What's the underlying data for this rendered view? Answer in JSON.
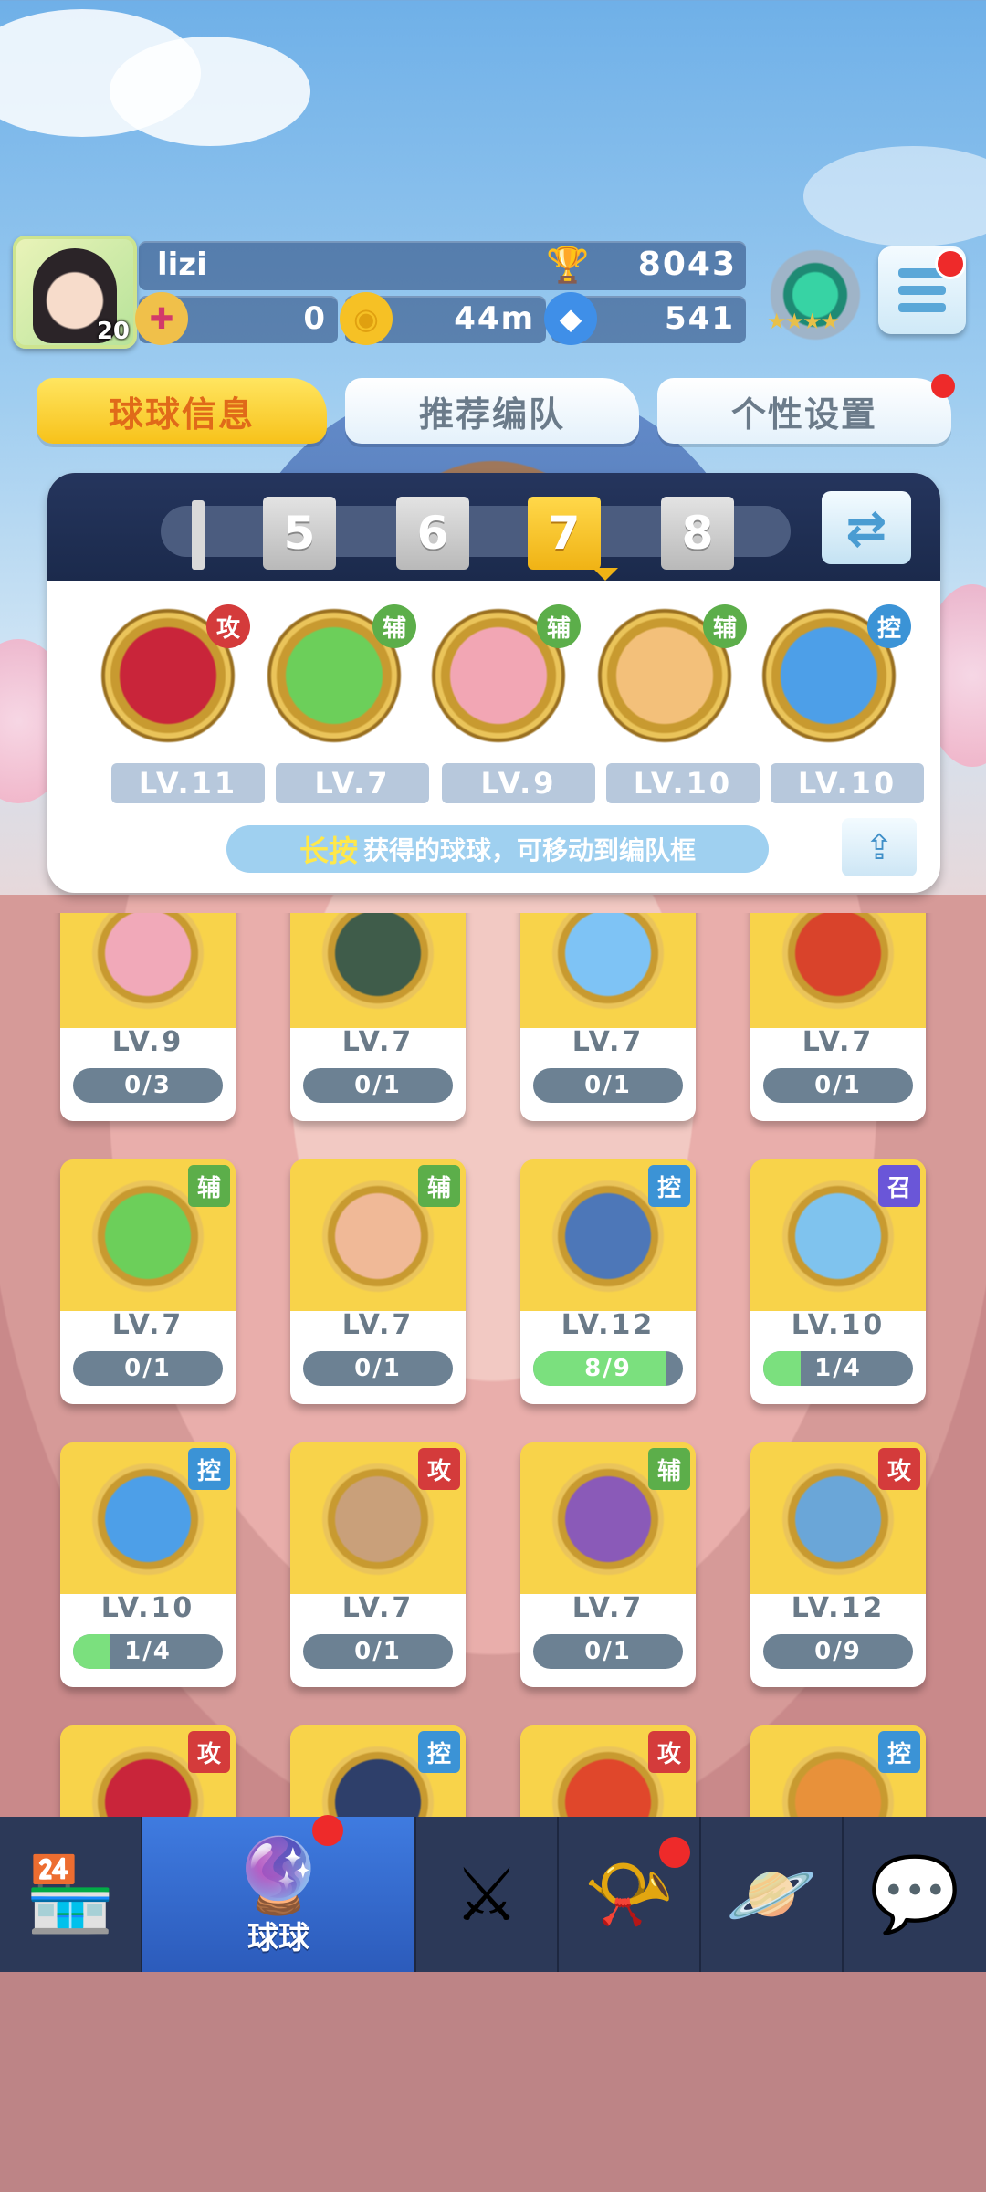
{
  "player": {
    "name": "lizi",
    "level": "20",
    "trophies": "8043",
    "resource_1": "0",
    "gold": "44m",
    "gems": "541"
  },
  "tabs": [
    {
      "label": "球球信息",
      "active": true
    },
    {
      "label": "推荐编队",
      "active": false
    },
    {
      "label": "个性设置",
      "active": false,
      "badge": true
    }
  ],
  "team": {
    "slots": [
      "5",
      "6",
      "7",
      "8"
    ],
    "selected_slot": "7",
    "members": [
      {
        "level": "LV.11",
        "tag": "攻",
        "color": "#c9253a"
      },
      {
        "level": "LV.7",
        "tag": "辅",
        "color": "#6ccf5a"
      },
      {
        "level": "LV.9",
        "tag": "辅",
        "color": "#f2a6b4"
      },
      {
        "level": "LV.10",
        "tag": "辅",
        "color": "#f3c07a"
      },
      {
        "level": "LV.10",
        "tag": "控",
        "color": "#4d9fe8"
      }
    ],
    "hint_highlight": "长按",
    "hint_text": "获得的球球，可移动到编队框"
  },
  "cards": [
    {
      "level": "LV.9",
      "progress": "0/3",
      "fill": 0,
      "tag": "",
      "color": "#f1a9b9"
    },
    {
      "level": "LV.7",
      "progress": "0/1",
      "fill": 0,
      "tag": "",
      "color": "#3f5c4a"
    },
    {
      "level": "LV.7",
      "progress": "0/1",
      "fill": 0,
      "tag": "",
      "color": "#7ec3f5"
    },
    {
      "level": "LV.7",
      "progress": "0/1",
      "fill": 0,
      "tag": "",
      "color": "#d9432b"
    },
    {
      "level": "LV.7",
      "progress": "0/1",
      "fill": 0,
      "tag": "辅",
      "color": "#6ccf5a"
    },
    {
      "level": "LV.7",
      "progress": "0/1",
      "fill": 0,
      "tag": "辅",
      "color": "#f0b997"
    },
    {
      "level": "LV.12",
      "progress": "8/9",
      "fill": 0.89,
      "tag": "控",
      "color": "#4d77b8"
    },
    {
      "level": "LV.10",
      "progress": "1/4",
      "fill": 0.25,
      "tag": "召",
      "color": "#7fc3ee"
    },
    {
      "level": "LV.10",
      "progress": "1/4",
      "fill": 0.25,
      "tag": "控",
      "color": "#4d9fe8"
    },
    {
      "level": "LV.7",
      "progress": "0/1",
      "fill": 0,
      "tag": "攻",
      "color": "#c9a07a"
    },
    {
      "level": "LV.7",
      "progress": "0/1",
      "fill": 0,
      "tag": "辅",
      "color": "#8a5ab8"
    },
    {
      "level": "LV.12",
      "progress": "0/9",
      "fill": 0,
      "tag": "攻",
      "color": "#6aa6d8"
    },
    {
      "level": "",
      "progress": "",
      "fill": 0,
      "tag": "攻",
      "color": "#c9253a"
    },
    {
      "level": "",
      "progress": "",
      "fill": 0,
      "tag": "控",
      "color": "#2e3f6a"
    },
    {
      "level": "",
      "progress": "",
      "fill": 0,
      "tag": "攻",
      "color": "#e0472b"
    },
    {
      "level": "",
      "progress": "",
      "fill": 0,
      "tag": "控",
      "color": "#e8913a"
    }
  ],
  "nav": [
    {
      "icon": "shop-icon",
      "label": "",
      "badge": false
    },
    {
      "icon": "ball-icon",
      "label": "球球",
      "badge": true,
      "active": true
    },
    {
      "icon": "crossed-swords-icon",
      "label": "",
      "badge": false
    },
    {
      "icon": "whistle-icon",
      "label": "",
      "badge": true
    },
    {
      "icon": "planet-icon",
      "label": "",
      "badge": false
    },
    {
      "icon": "chat-heart-icon",
      "label": "",
      "badge": false
    }
  ]
}
